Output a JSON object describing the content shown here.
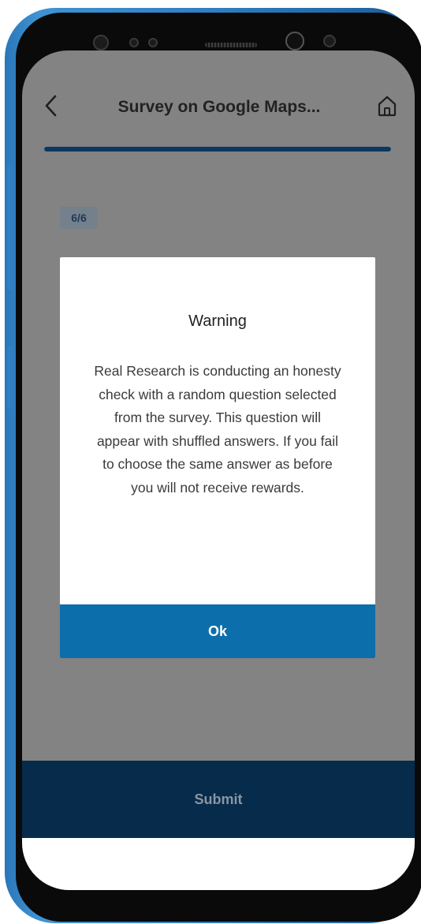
{
  "header": {
    "title": "Survey on Google Maps...",
    "back_icon": "chevron-left-icon",
    "home_icon": "home-icon"
  },
  "progress": {
    "counter": "6/6",
    "fraction": 1.0
  },
  "dialog": {
    "title": "Warning",
    "message": "Real Research is conducting an honesty check with a random question selected from the survey. This question will appear with shuffled answers. If you fail to choose the same answer as before you will not receive rewards.",
    "ok_label": "Ok"
  },
  "footer": {
    "submit_label": "Submit"
  },
  "colors": {
    "accent": "#0c6eab",
    "submit_background": "#062b4b",
    "overlay_background": "#838383",
    "device_frame": "#2f7fc1"
  }
}
